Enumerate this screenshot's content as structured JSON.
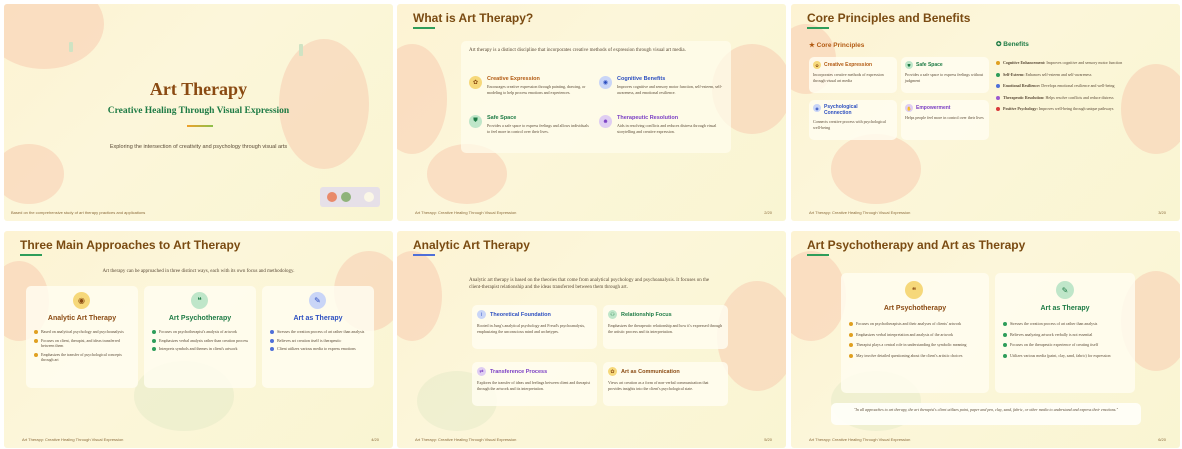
{
  "s1": {
    "title": "Art Therapy",
    "subtitle": "Creative Healing Through Visual Expression",
    "desc": "Exploring the intersection of creativity and psychology through visual arts",
    "footer": "Based on the comprehensive study of art therapy practices and applications"
  },
  "s2": {
    "title": "What is Art Therapy?",
    "intro": "Art therapy is a distinct discipline that incorporates creative methods of expression through visual art media.",
    "cards": [
      {
        "title": "Creative Expression",
        "text": "Encourages creative expression through painting, drawing, or modeling to help process emotions and experiences.",
        "icon": "palette-icon",
        "color": "#f3c04b"
      },
      {
        "title": "Cognitive Benefits",
        "text": "Improves cognitive and sensory motor function, self-esteem, self-awareness, and emotional resilience.",
        "icon": "brain-icon",
        "color": "#4f6fd8"
      },
      {
        "title": "Safe Space",
        "text": "Provides a safe space to express feelings and allows individuals to feel more in control over their lives.",
        "icon": "shield-icon",
        "color": "#2e9d5a"
      },
      {
        "title": "Therapeutic Resolution",
        "text": "Aids in resolving conflicts and reduces distress through visual storytelling and creative expression.",
        "icon": "mask-icon",
        "color": "#9b59d0"
      }
    ],
    "footer": "Art Therapy: Creative Healing Through Visual Expression",
    "page": "2/20"
  },
  "s3": {
    "title": "Core Principles and Benefits",
    "left_head": "Core Principles",
    "right_head": "Benefits",
    "principles": [
      {
        "title": "Creative Expression",
        "text": "Incorporates creative methods of expression through visual art media"
      },
      {
        "title": "Safe Space",
        "text": "Provides a safe space to express feelings without judgment"
      },
      {
        "title": "Psychological Connection",
        "text": "Connects creative process with psychological well-being"
      },
      {
        "title": "Empowerment",
        "text": "Helps people feel more in control over their lives"
      }
    ],
    "benefits": [
      {
        "label": "Cognitive Enhancement:",
        "text": "Improves cognitive and sensory motor function",
        "color": "#e0a020"
      },
      {
        "label": "Self-Esteem:",
        "text": "Enhances self-esteem and self-awareness",
        "color": "#2e9d5a"
      },
      {
        "label": "Emotional Resilience:",
        "text": "Develops emotional resilience and well-being",
        "color": "#4f6fd8"
      },
      {
        "label": "Therapeutic Resolution:",
        "text": "Helps resolve conflicts and reduce distress",
        "color": "#9b59d0"
      },
      {
        "label": "Positive Psychology:",
        "text": "Improves well-being through unique pathways",
        "color": "#d93a3a"
      }
    ],
    "footer": "Art Therapy: Creative Healing Through Visual Expression",
    "page": "3/20"
  },
  "s4": {
    "title": "Three Main Approaches to Art Therapy",
    "intro": "Art therapy can be approached in three distinct ways, each with its own focus and methodology.",
    "cols": [
      {
        "title": "Analytic Art Therapy",
        "items": [
          "Based on analytical psychology and psychoanalysis",
          "Focuses on client, therapist, and ideas transferred between them",
          "Emphasizes the transfer of psychological concepts through art"
        ]
      },
      {
        "title": "Art Psychotherapy",
        "items": [
          "Focuses on psychotherapist's analysis of artwork",
          "Emphasizes verbal analysis rather than creation process",
          "Interprets symbols and themes in client's artwork"
        ]
      },
      {
        "title": "Art as Therapy",
        "items": [
          "Stresses the creation process of art rather than analysis",
          "Believes art creation itself is therapeutic",
          "Client utilizes various media to express emotions"
        ]
      }
    ],
    "footer": "Art Therapy: Creative Healing Through Visual Expression",
    "page": "4/20"
  },
  "s5": {
    "title": "Analytic Art Therapy",
    "intro": "Analytic art therapy is based on the theories that come from analytical psychology and psychoanalysis. It focuses on the client-therapist relationship and the ideas transferred between them through art.",
    "cards": [
      {
        "title": "Theoretical Foundation",
        "text": "Rooted in Jung's analytical psychology and Freud's psychoanalysis, emphasizing the unconscious mind and archetypes."
      },
      {
        "title": "Relationship Focus",
        "text": "Emphasizes the therapeutic relationship and how it's expressed through the artistic process and its interpretation."
      },
      {
        "title": "Transference Process",
        "text": "Explores the transfer of ideas and feelings between client and therapist through the artwork and its interpretation."
      },
      {
        "title": "Art as Communication",
        "text": "Views art creation as a form of non-verbal communication that provides insights into the client's psychological state."
      }
    ],
    "footer": "Art Therapy: Creative Healing Through Visual Expression",
    "page": "5/20"
  },
  "s6": {
    "title": "Art Psychotherapy and Art as Therapy",
    "left": {
      "title": "Art Psychotherapy",
      "items": [
        "Focuses on psychotherapists and their analyses of clients' artwork",
        "Emphasizes verbal interpretation and analysis of the artwork",
        "Therapist plays a central role in understanding the symbolic meaning",
        "May involve detailed questioning about the client's artistic choices"
      ]
    },
    "right": {
      "title": "Art as Therapy",
      "items": [
        "Stresses the creation process of art rather than analysis",
        "Believes analyzing artwork verbally is not essential",
        "Focuses on the therapeutic experience of creating itself",
        "Utilizes various media (paint, clay, sand, fabric) for expression"
      ]
    },
    "quote": "\"In all approaches to art therapy, the art therapist's client utilizes paint, paper and pen, clay, sand, fabric, or other media to understand and express their emotions.\"",
    "footer": "Art Therapy: Creative Healing Through Visual Expression",
    "page": "6/20"
  }
}
